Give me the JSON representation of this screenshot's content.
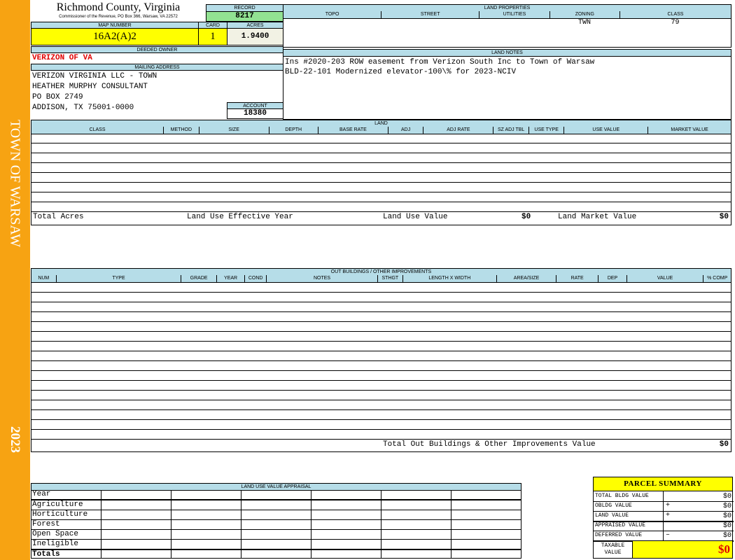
{
  "sidebar": {
    "town": "TOWN OF WARSAW",
    "year": "2023"
  },
  "header": {
    "county": "Richmond County, Virginia",
    "subtitle": "Commissioner of the Revenue, PO Box 366, Warsaw, VA 22572",
    "record_label": "RECORD",
    "record_value": "8217",
    "map_label": "MAP NUMBER",
    "map_value": "16A2(A)2",
    "card_label": "CARD",
    "card_value": "1",
    "acres_label": "ACRES",
    "acres_value": "1.9400"
  },
  "owner": {
    "label": "DEEDED OWNER",
    "name": "VERIZON OF VA"
  },
  "mailing": {
    "label": "MAILING ADDRESS",
    "lines": [
      "VERIZON VIRGINIA LLC - TOWN",
      "HEATHER MURPHY CONSULTANT",
      "PO BOX 2749",
      "ADDISON, TX 75001-0000"
    ]
  },
  "account": {
    "label": "ACCOUNT",
    "value": "18380"
  },
  "land_properties": {
    "title": "LAND PROPERTIES",
    "columns": [
      "TOPO",
      "STREET",
      "UTILITIES",
      "ZONING",
      "CLASS"
    ],
    "values": [
      "",
      "",
      "",
      "TWN",
      "79"
    ]
  },
  "land_notes": {
    "title": "LAND NOTES",
    "lines": [
      "Ins #2020-203 ROW easement from Verizon South Inc to Town of Warsaw",
      "BLD-22-101 Modernized elevator-100\\% for 2023-NCIV"
    ]
  },
  "land": {
    "title": "LAND",
    "columns": [
      "CLASS",
      "METHOD",
      "SIZE",
      "DEPTH",
      "BASE RATE",
      "ADJ",
      "ADJ RATE",
      "SZ ADJ TBL",
      "USE TYPE",
      "USE VALUE",
      "MARKET VALUE"
    ],
    "total_acres_label": "Total Acres",
    "effective_year_label": "Land Use Effective Year",
    "use_value_label": "Land Use Value",
    "use_value": "$0",
    "market_value_label": "Land Market Value",
    "market_value": "$0"
  },
  "outbuildings": {
    "title": "OUT BUILDINGS / OTHER IMPROVEMENTS",
    "columns": [
      "NUM",
      "TYPE",
      "GRADE",
      "YEAR",
      "COND",
      "NOTES",
      "STHGT",
      "LENGTH X WIDTH",
      "AREA/SIZE",
      "RATE",
      "DEP",
      "VALUE",
      "% COMP"
    ],
    "total_label": "Total Out Buildings & Other Improvements Value",
    "total_value": "$0"
  },
  "land_use": {
    "title": "LAND USE VALUE APPRAISAL",
    "rows": [
      "Year",
      "Agriculture",
      "Horticulture",
      "Forest",
      "Open Space",
      "Ineligible",
      "Totals"
    ]
  },
  "parcel_summary": {
    "title": "PARCEL SUMMARY",
    "rows": [
      {
        "label": "TOTAL BLDG VALUE",
        "sign": "",
        "value": "$0"
      },
      {
        "label": "OBLDG VALUE",
        "sign": "+",
        "value": "$0"
      },
      {
        "label": "LAND VALUE",
        "sign": "+",
        "value": "$0"
      },
      {
        "label": "APPRAISED VALUE",
        "sign": "",
        "value": "$0"
      },
      {
        "label": "DEFERRED VALUE",
        "sign": "–",
        "value": "$0"
      }
    ],
    "taxable_label": "TAXABLE VALUE",
    "taxable_value": "$0"
  }
}
